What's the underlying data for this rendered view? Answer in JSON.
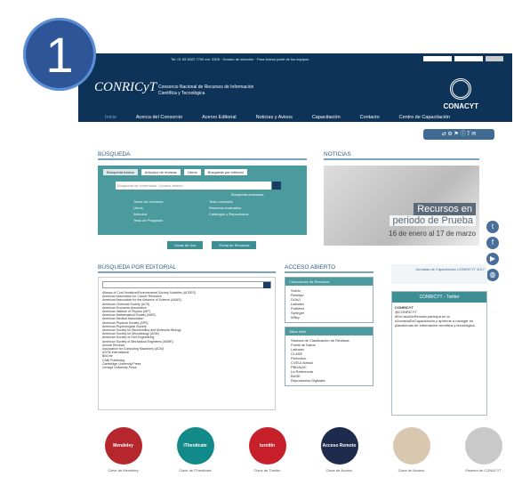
{
  "badge": "1",
  "topbar": {
    "text": "Tel: 01 55 5322 7700 ext. 3305 · Horario de atención · Para formar parte de los equipos"
  },
  "header": {
    "logo": "CONRICyT",
    "title": "Consorcio Nacional de Recursos de Información Científica y Tecnológica",
    "brand": "CONACYT"
  },
  "nav": [
    "Inicio",
    "Acerca del Consorcio",
    "Acervo Editorial",
    "Noticias y Avisos",
    "Capacitación",
    "Contacto",
    "Centro de Capacitación"
  ],
  "share": "⇄ ⚙ ⚑ ⓘ T ✉",
  "busqueda": {
    "heading": "BÚSQUEDA",
    "tabs": [
      "Búsqueda básica",
      "Artículos de revistas",
      "Libros",
      "Búsqueda por editorial"
    ],
    "placeholder": "Búsqueda de contenidos / Acceso abierto",
    "link": "Búsqueda avanzada",
    "options": [
      "Todos los recursos",
      "Libros",
      "Artículos",
      "Tesis de Posgrado"
    ],
    "options2": [
      "Texto completo",
      "Recursos evaluados",
      "Catálogos y Repositorios"
    ],
    "btn1": "Guías de Uso",
    "btn2": "Portal de Recursos"
  },
  "noticias": {
    "heading": "NOTICIAS",
    "line1": "Recursos en",
    "line2": "periodo de Prueba",
    "line3": "16 de enero al 17 de marzo"
  },
  "social": [
    "t",
    "f",
    "▶",
    "◍"
  ],
  "editorial": {
    "heading": "BÚSQUEDA POR EDITORIAL",
    "items": [
      "Alianza of Cost Sensitive/Environmental Society Societies (ACEEG)",
      "American Association for Cancer Research",
      "American Association for the Advance of Science (AAAS)",
      "American Chemical Society (ACS)",
      "American Economic Association",
      "American Institute of Physics (AIP)",
      "American Mathematical Society (AMS)",
      "American Medical Association",
      "American Physical Society (APS)",
      "American Psychological Society",
      "American Society for Biochemistry and Molecular Biology",
      "American Society for Microbiology (ASM)",
      "American Society of Civil Engineering",
      "American Society of Mechanical Engineers (ASME)",
      "Annual Reviews",
      "Association for Computing Machinery (ACM)",
      "ASTM International",
      "BioOne",
      "CABI Publishing",
      "Cambridge University Press",
      "Cenage University Press"
    ]
  },
  "abierto": {
    "heading": "ACCESO ABIERTO",
    "box1": "Colecciones de Recursos",
    "b1items": [
      "Scielo",
      "Redalyc",
      "DOAJ",
      "Latindex",
      "PubMed",
      "Springer",
      "Wiley"
    ],
    "box2": "Sitios Web",
    "b2items": [
      "Sistema de Clasificación de Revistas",
      "Portal de Datos",
      "Latindex",
      "CLASE",
      "Periódica",
      "CVEUI-Nebuli",
      "PBDAUIC",
      "La Referencia",
      "BASE",
      "Repositorios Digitales"
    ]
  },
  "capacitacion": {
    "banner": "Jornadas de Capacitación CONRICYT 2017",
    "tw_head": "CONRICYT - Twitter",
    "tw_user": "CONRICYT",
    "tw_handle": "@CONRICYT",
    "tw_text": "#EnCasaDeRemota participa en la #JornadaDeCapacitación y aprende a navegar en plataformas de información científica y tecnológica."
  },
  "logos": [
    {
      "name": "Mendeley",
      "label": "Clave de Mendeley",
      "color": "#b5262d"
    },
    {
      "name": "iThenticate",
      "label": "Clave de iThenticate",
      "color": "#138a8a"
    },
    {
      "name": "turnitin",
      "label": "Clave de Turnitin",
      "color": "#c8202a"
    },
    {
      "name": "Acceso Remoto",
      "label": "Clave de Acceso",
      "color": "#1d2b4c"
    },
    {
      "name": "",
      "label": "Clave de Acceso",
      "color": "#d9c7b0"
    },
    {
      "name": "",
      "label": "Sistema de CONACYT",
      "color": "#c9c9c9"
    }
  ]
}
